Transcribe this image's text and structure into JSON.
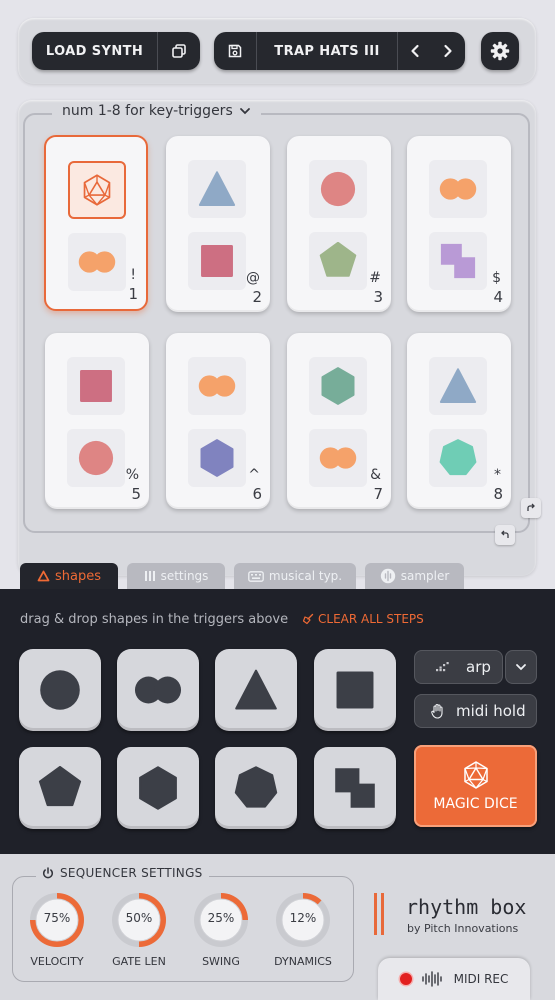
{
  "toolbar": {
    "load_synth": "LOAD SYNTH",
    "preset_name": "TRAP HATS III"
  },
  "grid": {
    "hint": "num 1-8 for key-triggers",
    "cards": [
      {
        "symbol": "!",
        "number": "1",
        "top": "dice",
        "bottom": "double-circle",
        "active": true
      },
      {
        "symbol": "@",
        "number": "2",
        "top": "triangle",
        "bottom": "square"
      },
      {
        "symbol": "#",
        "number": "3",
        "top": "circle",
        "bottom": "pentagon"
      },
      {
        "symbol": "$",
        "number": "4",
        "top": "double-circle",
        "bottom": "stacked-squares"
      },
      {
        "symbol": "%",
        "number": "5",
        "top": "square",
        "bottom": "circle"
      },
      {
        "symbol": "^",
        "number": "6",
        "top": "double-circle",
        "bottom": "hexagon"
      },
      {
        "symbol": "&",
        "number": "7",
        "top": "hexagon",
        "bottom": "double-circle"
      },
      {
        "symbol": "*",
        "number": "8",
        "top": "triangle",
        "bottom": "heptagon"
      }
    ]
  },
  "tabs": [
    {
      "label": "shapes",
      "icon": "triangle-icon",
      "active": true
    },
    {
      "label": "settings",
      "icon": "bars-icon"
    },
    {
      "label": "musical typ.",
      "icon": "keyboard-icon"
    },
    {
      "label": "sampler",
      "icon": "sampler-icon"
    }
  ],
  "shapes_panel": {
    "hint": "drag & drop shapes in the triggers above",
    "clear_all": "CLEAR ALL STEPS",
    "shapes": [
      "circle",
      "double-circle",
      "triangle",
      "square",
      "pentagon",
      "hexagon",
      "heptagon",
      "stacked-squares"
    ],
    "arp_label": "arp",
    "midi_hold_label": "midi hold",
    "magic_dice_label": "MAGIC DICE"
  },
  "sequencer": {
    "title": "SEQUENCER SETTINGS",
    "knobs": [
      {
        "label": "VELOCITY",
        "value": "75%"
      },
      {
        "label": "GATE LEN",
        "value": "50%"
      },
      {
        "label": "SWING",
        "value": "25%"
      },
      {
        "label": "DYNAMICS",
        "value": "12%"
      }
    ]
  },
  "brand": {
    "title": "rhythm box",
    "subtitle": "by Pitch Innovations"
  },
  "midi_rec": "MIDI REC",
  "colors": {
    "accent": "#ec6a38",
    "dark_panel": "#1f2129",
    "shape_orange": "#f5a26a",
    "shape_blue": "#8fa9c6",
    "shape_red": "#de8584",
    "shape_green": "#9eb58a",
    "shape_purple": "#b99ad6",
    "shape_rose": "#cd6f82",
    "shape_indigo": "#8083bf",
    "shape_teal": "#6fcdb5",
    "shape_sea": "#77ad99"
  }
}
